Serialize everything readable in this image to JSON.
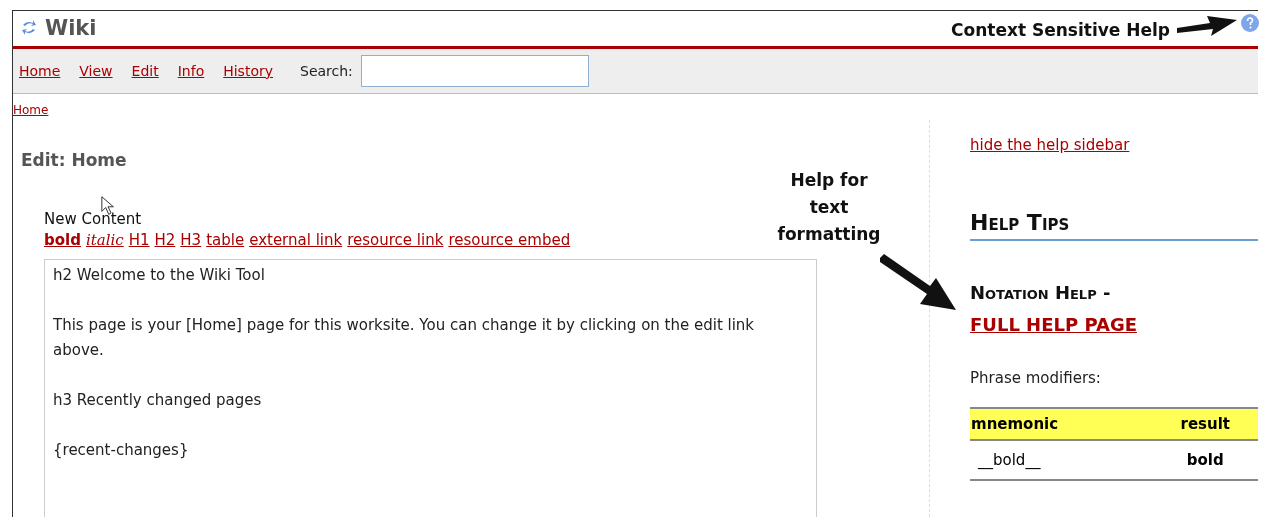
{
  "header": {
    "title": "Wiki"
  },
  "annotations": [
    {
      "kind": "help",
      "text": "Context Sensitive Help"
    },
    {
      "kind": "format",
      "text": "Help for text formatting"
    }
  ],
  "nav": {
    "links": [
      "Home",
      "View",
      "Edit",
      "Info",
      "History"
    ],
    "search_label": "Search:"
  },
  "breadcrumb": "Home",
  "edit": {
    "heading": "Edit: Home",
    "field_label": "New Content",
    "toolbar": [
      {
        "label": "bold",
        "kind": "bold"
      },
      {
        "label": "italic",
        "kind": "italic"
      },
      {
        "label": "H1",
        "kind": "plain"
      },
      {
        "label": "H2",
        "kind": "plain"
      },
      {
        "label": "H3",
        "kind": "plain"
      },
      {
        "label": "table",
        "kind": "plain"
      },
      {
        "label": "external link",
        "kind": "plain"
      },
      {
        "label": "resource link",
        "kind": "plain"
      },
      {
        "label": "resource embed",
        "kind": "plain"
      }
    ],
    "value": "h2 Welcome to the Wiki Tool\n\nThis page is your [Home] page for this worksite. You can change it by clicking on the edit link above.\n\nh3 Recently changed pages\n\n{recent-changes}"
  },
  "sidebar": {
    "hide_link": "hide the help sidebar",
    "title": "Help Tips",
    "notation_title": "Notation Help - ",
    "full_help_link": "FULL HELP PAGE",
    "phrase_label": "Phrase modifiers:",
    "table": {
      "columns": [
        "mnemonic",
        "result"
      ],
      "rows": [
        {
          "mnemonic": "__bold__",
          "result": "bold"
        }
      ]
    }
  }
}
